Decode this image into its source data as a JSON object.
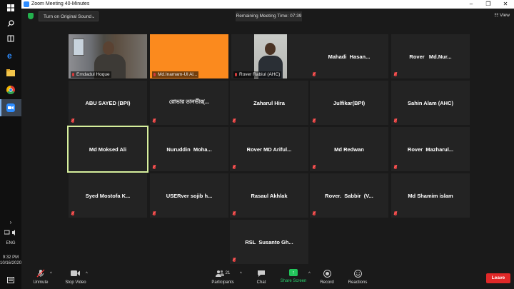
{
  "window": {
    "title": "Zoom Meeting 40-Minutes"
  },
  "topbar": {
    "original_sound": "Turn on Original Sound",
    "remaining_time": "Remaining Meeting Time: 07:39",
    "view": "View"
  },
  "participants": [
    {
      "label": "Emdadul Hoque",
      "video": "camera"
    },
    {
      "label": "Md.Inamam-Ul Al...",
      "video": "orange"
    },
    {
      "label": "Rover Rabiul (AHC)",
      "video": "camera"
    },
    {
      "name": "Mahadi  Hasan..."
    },
    {
      "name": "Rover   Md.Nur..."
    },
    {
      "name": "ABU SAYED (BPI)"
    },
    {
      "name": "রোভার তানভীর(..."
    },
    {
      "name": "Zaharul Hira"
    },
    {
      "name": "Julfikar(BPI)"
    },
    {
      "name": "Sahin Alam (AHC)"
    },
    {
      "name": "Md Moksed Ali",
      "active": true
    },
    {
      "name": "Nuruddin  Moha..."
    },
    {
      "name": "Rover MD Ariful..."
    },
    {
      "name": "Md Redwan"
    },
    {
      "name": "Rover  Mazharul..."
    },
    {
      "name": "Syed Mostofa K..."
    },
    {
      "name": "USERver sojib h..."
    },
    {
      "name": "Rasaul Akhlak"
    },
    {
      "name": "Rover.  Sabbir  (V..."
    },
    {
      "name": "Md Shamim islam"
    },
    {
      "name": "RSL  Susanto Gh..."
    }
  ],
  "toolbar": {
    "unmute": "Unmute",
    "stop_video": "Stop Video",
    "participants": "Participants",
    "participant_count": "21",
    "chat": "Chat",
    "share_screen": "Share Screen",
    "record": "Record",
    "reactions": "Reactions",
    "leave": "Leave"
  },
  "tray": {
    "lang": "ENG",
    "time": "9:32 PM",
    "date": "10/16/2020"
  },
  "colors": {
    "leave": "#e02828",
    "share": "#22c65b",
    "active_speaker": "#d6ef9d",
    "orange_tile": "#fb8a1e"
  }
}
